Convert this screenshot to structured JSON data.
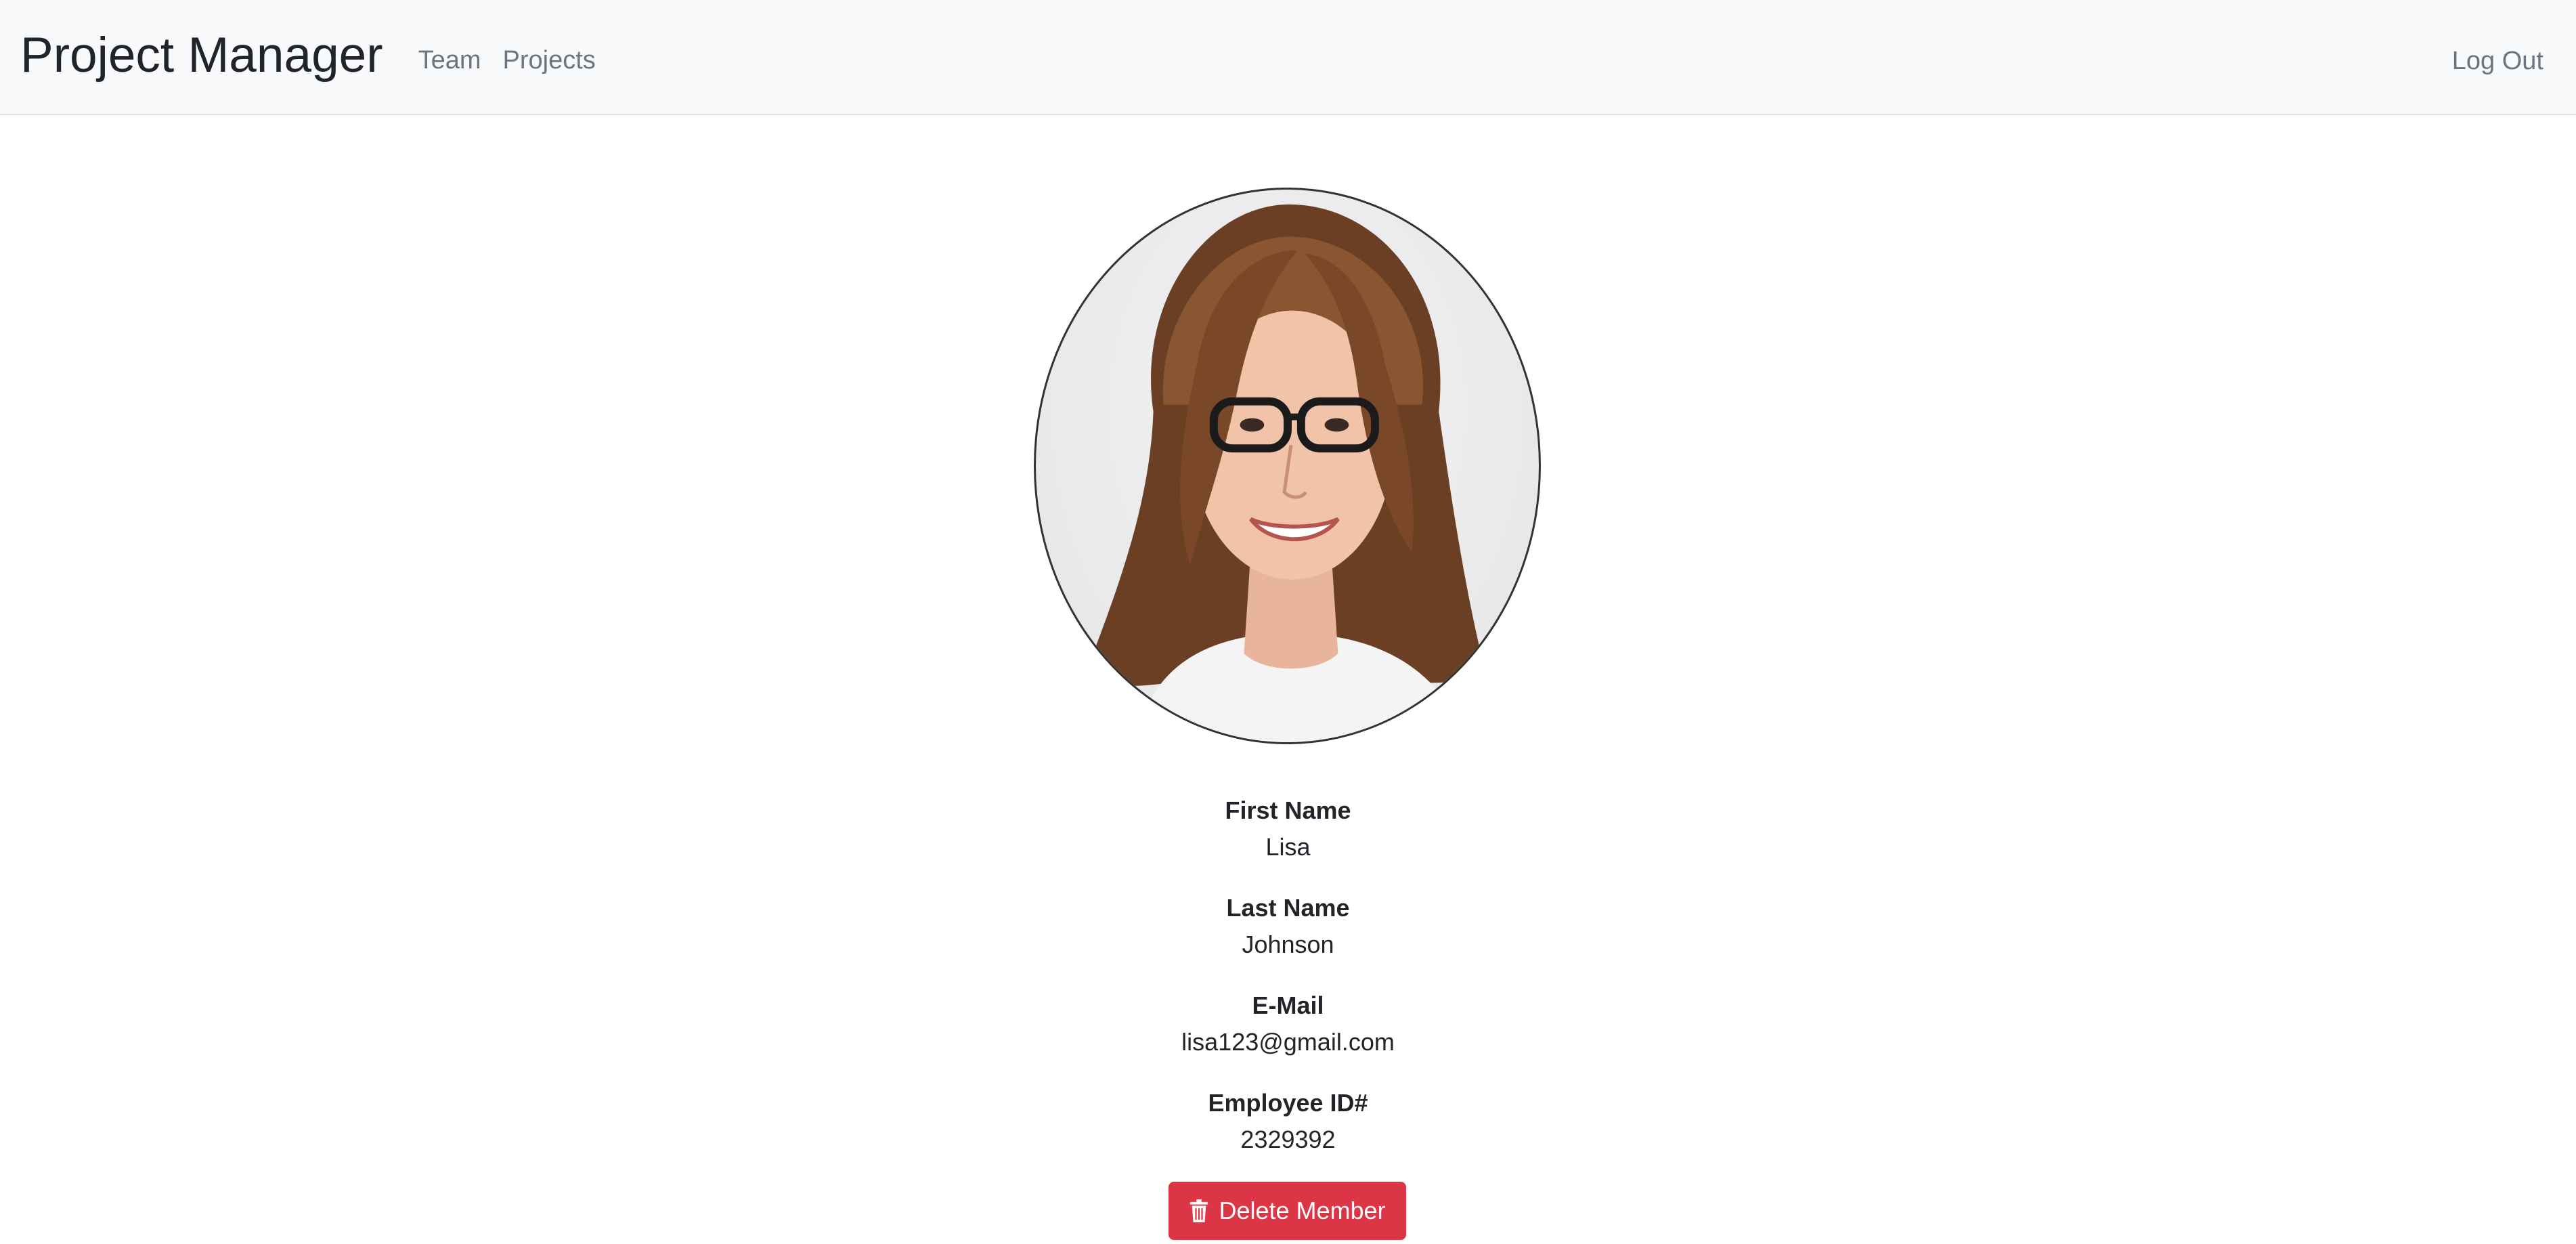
{
  "navbar": {
    "brand": "Project Manager",
    "links": [
      "Team",
      "Projects"
    ],
    "logout": "Log Out"
  },
  "profile": {
    "avatar_icon": "profile-photo",
    "fields": [
      {
        "label": "First Name",
        "value": "Lisa"
      },
      {
        "label": "Last Name",
        "value": "Johnson"
      },
      {
        "label": "E-Mail",
        "value": "lisa123@gmail.com"
      },
      {
        "label": "Employee ID#",
        "value": "2329392"
      }
    ]
  },
  "actions": {
    "delete_label": "Delete Member",
    "delete_icon": "trash-icon",
    "delete_color": "#dc3545"
  }
}
